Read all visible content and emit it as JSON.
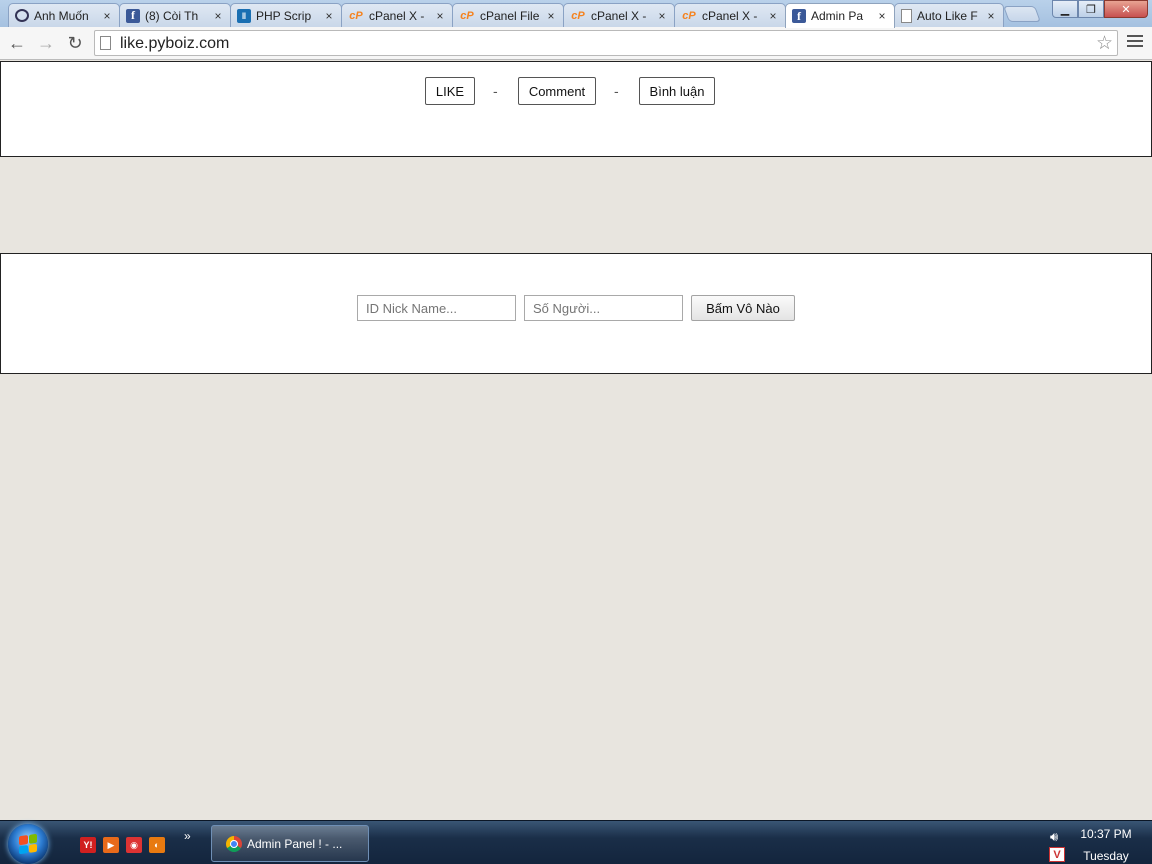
{
  "browser": {
    "tabs": [
      {
        "label": "Anh Muốn",
        "icon": "ring-icon",
        "active": false
      },
      {
        "label": "(8) Còi Th",
        "icon": "facebook-icon",
        "active": false
      },
      {
        "label": "PHP Scrip",
        "icon": "php-icon",
        "active": false
      },
      {
        "label": "cPanel X -",
        "icon": "cpanel-icon",
        "active": false
      },
      {
        "label": "cPanel File",
        "icon": "cpanel-icon",
        "active": false
      },
      {
        "label": "cPanel X -",
        "icon": "cpanel-icon",
        "active": false
      },
      {
        "label": "cPanel X -",
        "icon": "cpanel-icon",
        "active": false
      },
      {
        "label": "Admin Pa",
        "icon": "facebook-icon",
        "active": true
      },
      {
        "label": "Auto Like F",
        "icon": "document-icon",
        "active": false
      }
    ],
    "close_glyph": "×",
    "url": "like.pyboiz.com"
  },
  "nav_panel": {
    "like_label": "LIKE",
    "separator": "-",
    "comment_label": "Comment",
    "binh_luan_label": "Bình luận"
  },
  "form_panel": {
    "id_placeholder": "ID Nick Name...",
    "so_nguoi_placeholder": "Số Người...",
    "submit_label": "Bấm Vô Nào"
  },
  "taskbar": {
    "window_title": "Admin Panel ! - ...",
    "time": "10:37 PM",
    "day": "Tuesday",
    "quick_launch": [
      {
        "icon": "yahoo-icon",
        "glyph": "Y!",
        "color": "#d02020"
      },
      {
        "icon": "media-player-icon",
        "glyph": "▶",
        "color": "#e86a1a"
      },
      {
        "icon": "app-icon",
        "glyph": "◉",
        "color": "#d33"
      },
      {
        "icon": "firefox-icon",
        "glyph": "◐",
        "color": "#e87a10"
      }
    ]
  },
  "colors": {
    "page_background": "#e8e5df",
    "panel_background": "#ffffff",
    "panel_border": "#222222"
  }
}
